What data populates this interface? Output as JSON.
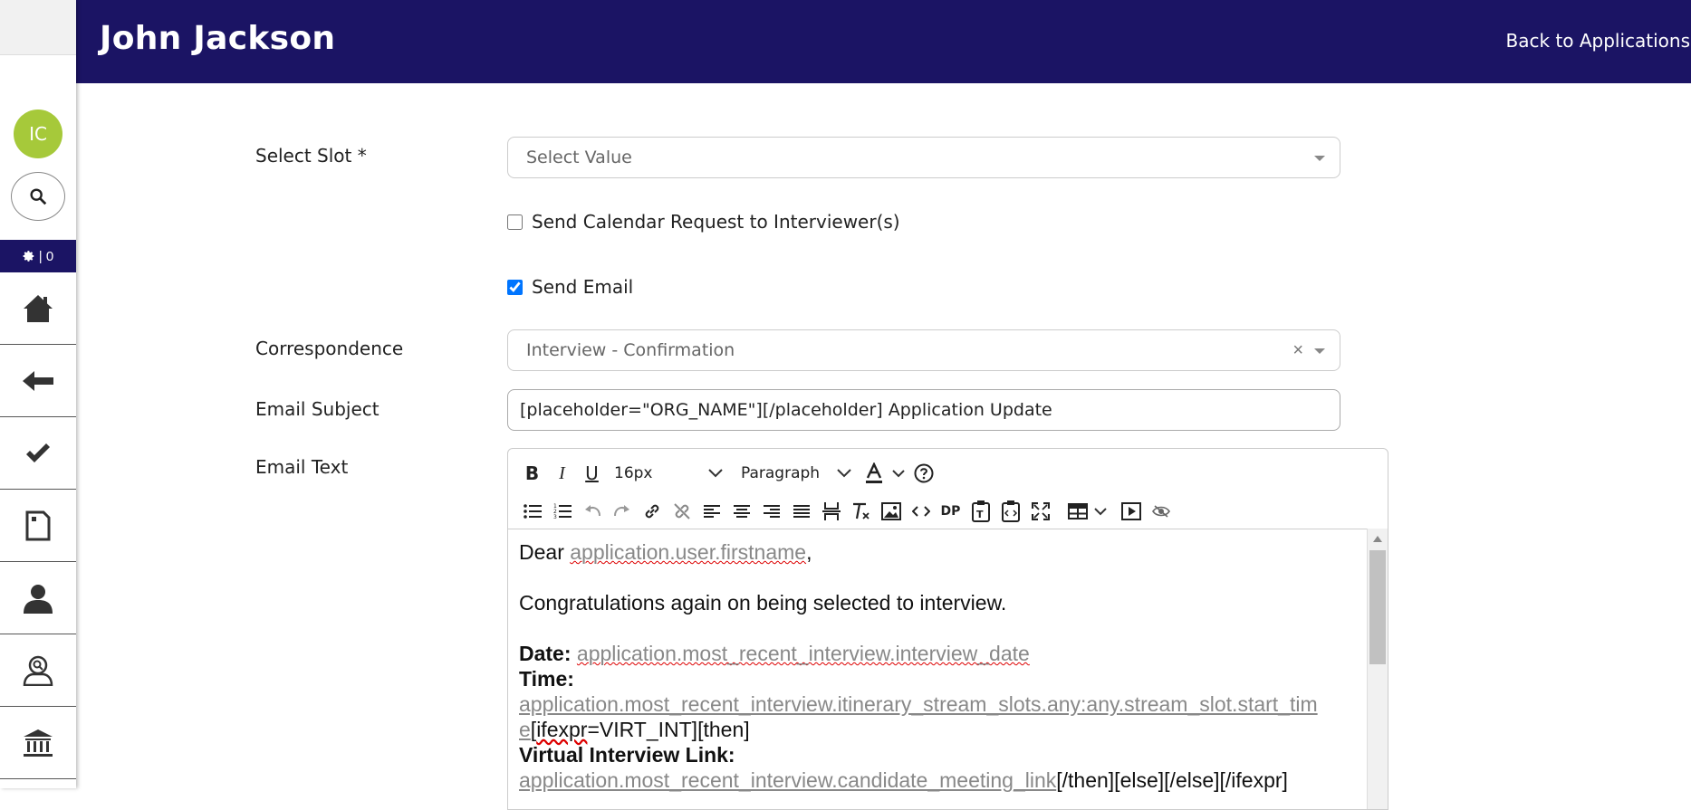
{
  "sidebar": {
    "avatar_initials": "IC",
    "status_count": "| 0",
    "nav_items": [
      "home",
      "back",
      "approve",
      "document",
      "profile",
      "interviewer",
      "institution"
    ]
  },
  "header": {
    "title": "John Jackson",
    "back_link": "Back to Applications"
  },
  "form": {
    "select_slot_label": "Select Slot *",
    "select_slot_placeholder": "Select Value",
    "calendar_request_label": "Send Calendar Request to Interviewer(s)",
    "calendar_request_checked": false,
    "send_email_label": "Send Email",
    "send_email_checked": true,
    "correspondence_label": "Correspondence",
    "correspondence_value": "Interview - Confirmation",
    "email_subject_label": "Email Subject",
    "email_subject_value": "[placeholder=\"ORG_NAME\"][/placeholder] Application Update",
    "email_text_label": "Email Text"
  },
  "editor": {
    "font_size": "16px",
    "block_format": "Paragraph",
    "dp_label": "DP",
    "content": {
      "greeting": "Dear ",
      "firstname_ph": "application.user.firstname",
      "comma": ",",
      "congrats": "Congratulations again on being selected to interview.",
      "date_label": "Date:",
      "date_ph": "application.most_recent_interview.interview_date",
      "time_label": "Time:",
      "time_ph_a": "application.most_recent_interview.itinerary_stream_slots.any:any.stream_slot.start_tim",
      "time_ph_b": "e",
      "ifexpr_word": "ifexpr",
      "ifexpr_rest": "=VIRT_INT][then]",
      "virtual_label": "Virtual Interview Link:",
      "link_ph": "application.most_recent_interview.candidate_meeting_link",
      "link_tail": "[/then][else][/else][/ifexpr]"
    }
  }
}
